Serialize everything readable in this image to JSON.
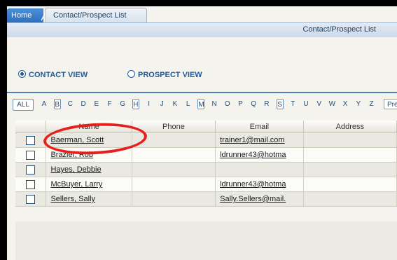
{
  "tabs": {
    "home": "Home",
    "active": "Contact/Prospect List"
  },
  "header": {
    "title": "Contact/Prospect List"
  },
  "views": {
    "contact": "CONTACT VIEW",
    "prospect": "PROSPECT VIEW",
    "selected": "contact"
  },
  "alphabet": {
    "all_label": "ALL",
    "letters": [
      "A",
      "B",
      "C",
      "D",
      "E",
      "F",
      "G",
      "H",
      "I",
      "J",
      "K",
      "L",
      "M",
      "N",
      "O",
      "P",
      "Q",
      "R",
      "S",
      "T",
      "U",
      "V",
      "W",
      "X",
      "Y",
      "Z"
    ],
    "boxed": [
      "B",
      "H",
      "M",
      "S"
    ],
    "prev_label": "Prev"
  },
  "grid": {
    "columns": [
      "",
      "Name",
      "Phone",
      "Email",
      "Address"
    ],
    "rows": [
      {
        "name": "Baerman, Scott",
        "phone": "",
        "email": "trainer1@mail.com",
        "address": ""
      },
      {
        "name": "Brazier, Rob",
        "phone": "",
        "email": "ldrunner43@hotma",
        "address": ""
      },
      {
        "name": "Hayes, Debbie",
        "phone": "",
        "email": "",
        "address": ""
      },
      {
        "name": "McBuyer, Larry",
        "phone": "",
        "email": "ldrunner43@hotma",
        "address": ""
      },
      {
        "name": "Sellers, Sally",
        "phone": "",
        "email": "Sally.Sellers@mail.",
        "address": ""
      }
    ]
  },
  "colors": {
    "highlight_circle": "#e3201b",
    "accent": "#1f5a9c"
  }
}
